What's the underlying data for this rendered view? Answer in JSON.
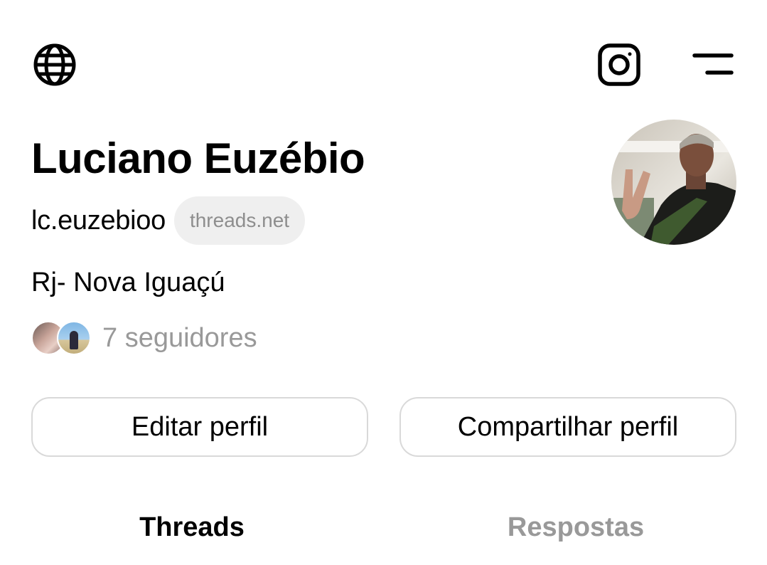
{
  "header": {
    "globe_icon": "globe-icon",
    "instagram_icon": "instagram-icon",
    "menu_icon": "menu-icon"
  },
  "profile": {
    "name": "Luciano Euzébio",
    "handle": "lc.euzebioo",
    "domain_badge": "threads.net",
    "bio": "Rj- Nova Iguaçú",
    "followers_text": "7 seguidores"
  },
  "actions": {
    "edit_label": "Editar perfil",
    "share_label": "Compartilhar perfil"
  },
  "tabs": [
    {
      "label": "Threads",
      "active": true
    },
    {
      "label": "Respostas",
      "active": false
    }
  ],
  "colors": {
    "text_primary": "#000000",
    "text_secondary": "#999999",
    "badge_bg": "#efefef",
    "button_border": "#d9d9d9"
  }
}
